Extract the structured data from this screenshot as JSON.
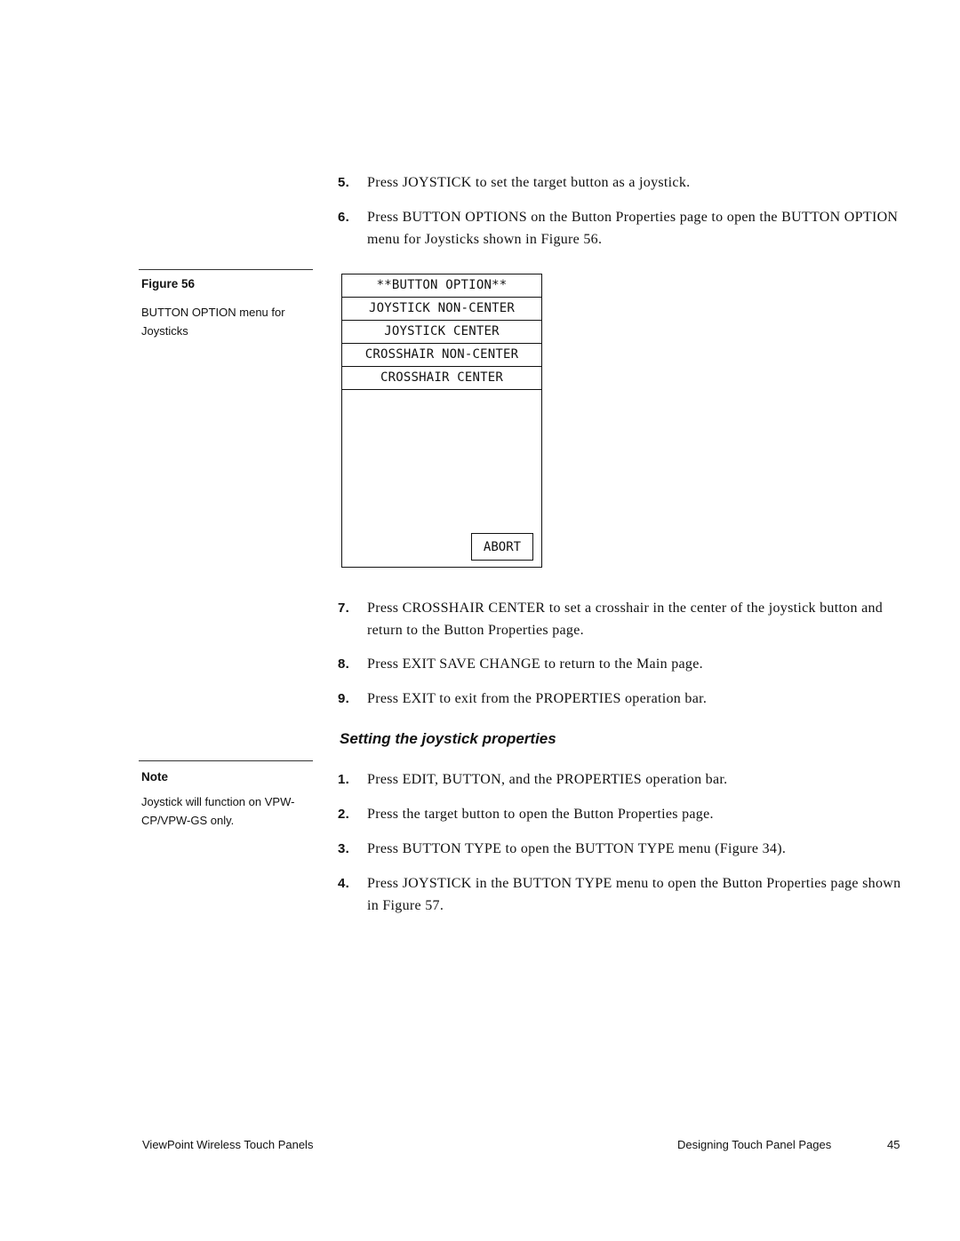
{
  "steps_top": [
    {
      "num": "5.",
      "text": "Press JOYSTICK to set the target button as a joystick."
    },
    {
      "num": "6.",
      "text": "Press BUTTON OPTIONS on the Button Properties page to open the BUTTON OPTION menu for Joysticks shown in Figure 56."
    }
  ],
  "figure": {
    "label": "Figure 56",
    "caption": "BUTTON OPTION menu for Joysticks"
  },
  "panel": {
    "title": "**BUTTON OPTION**",
    "options": [
      "JOYSTICK NON-CENTER",
      "JOYSTICK CENTER",
      "CROSSHAIR NON-CENTER",
      "CROSSHAIR CENTER"
    ],
    "abort_label": "ABORT"
  },
  "steps_mid": [
    {
      "num": "7.",
      "text": "Press CROSSHAIR CENTER to set a crosshair in the center of the joystick button and return to the Button Properties page."
    },
    {
      "num": "8.",
      "text": "Press EXIT SAVE CHANGE to return to the Main page."
    },
    {
      "num": "9.",
      "text": "Press EXIT to exit from the PROPERTIES operation bar."
    }
  ],
  "section_title": "Setting the joystick properties",
  "note": {
    "label": "Note",
    "text": "Joystick will function on VPW-CP/VPW-GS only."
  },
  "steps_bottom": [
    {
      "num": "1.",
      "text": "Press EDIT, BUTTON, and the PROPERTIES operation bar."
    },
    {
      "num": "2.",
      "text": "Press the target button to open the Button Properties page."
    },
    {
      "num": "3.",
      "text": "Press BUTTON TYPE to open the BUTTON TYPE menu (Figure 34)."
    },
    {
      "num": "4.",
      "text": "Press JOYSTICK in the BUTTON TYPE menu to open the Button Properties page shown in Figure 57."
    }
  ],
  "footer": {
    "left": "ViewPoint Wireless Touch Panels",
    "section": "Designing Touch Panel Pages",
    "page": "45"
  }
}
